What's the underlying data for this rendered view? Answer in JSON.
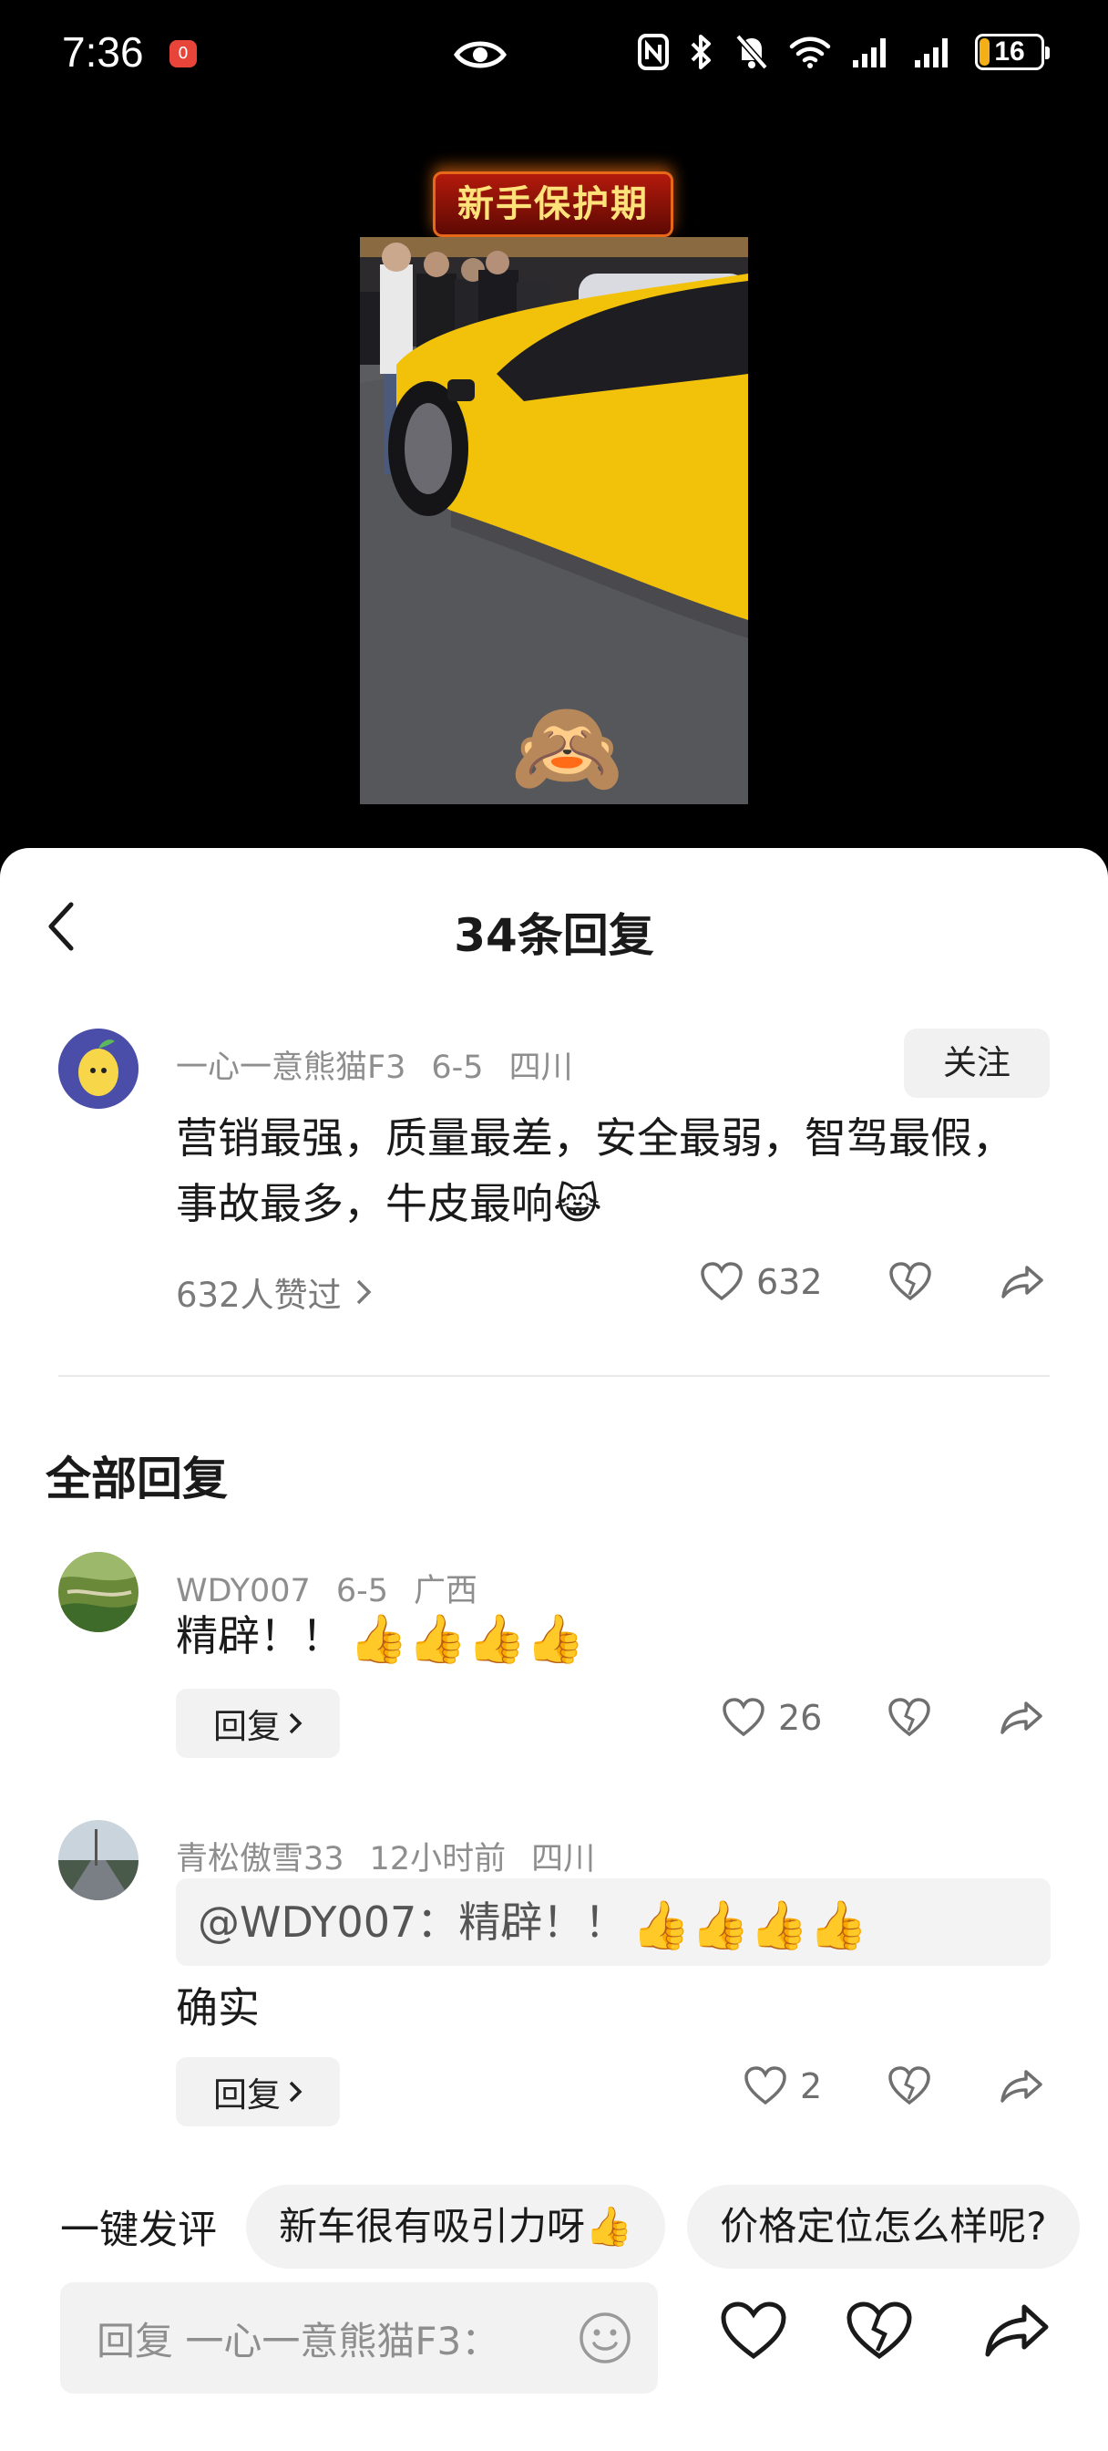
{
  "status_bar": {
    "time": "7:36",
    "notification_count": "0",
    "battery_level": "16",
    "battery_fraction": 0.16,
    "icons": [
      "eye-icon",
      "nfc-icon",
      "bluetooth-icon",
      "mute-icon",
      "wifi-icon",
      "signal-icon",
      "signal-icon",
      "battery-icon"
    ]
  },
  "video": {
    "badge_text": "新手保护期",
    "overlay_emoji": "🙈"
  },
  "sheet": {
    "title": "34条回复"
  },
  "main_comment": {
    "username": "一心一意熊猫F3",
    "date": "6-5",
    "location": "四川",
    "follow_label": "关注",
    "text": "营销最强，质量最差，安全最弱，智驾最假，事故最多，牛皮最响😹",
    "likes_summary": "632人赞过",
    "like_count": "632"
  },
  "replies_section": {
    "title": "全部回复",
    "replies": [
      {
        "username": "WDY007",
        "date": "6-5",
        "location": "广西",
        "text": "精辟！！",
        "emojis": "👍👍👍👍",
        "reply_label": "回复",
        "like_count": "26"
      },
      {
        "username": "青松傲雪33",
        "date": "12小时前",
        "location": "四川",
        "quote": "@WDY007：精辟！！",
        "quote_emojis": "👍👍👍👍",
        "text": "确实",
        "reply_label": "回复",
        "like_count": "2"
      }
    ]
  },
  "quick_comments": {
    "label": "一键发评",
    "chips": [
      "新车很有吸引力呀👍",
      "价格定位怎么样呢?"
    ]
  },
  "input": {
    "placeholder": "回复 一心一意熊猫F3："
  },
  "colors": {
    "background": "#000000",
    "sheet": "#ffffff",
    "muted_text": "#8e8e8e",
    "chip_bg": "#f2f2f2",
    "battery_fill": "#f5b018",
    "badge_red": "#b31a0c"
  }
}
